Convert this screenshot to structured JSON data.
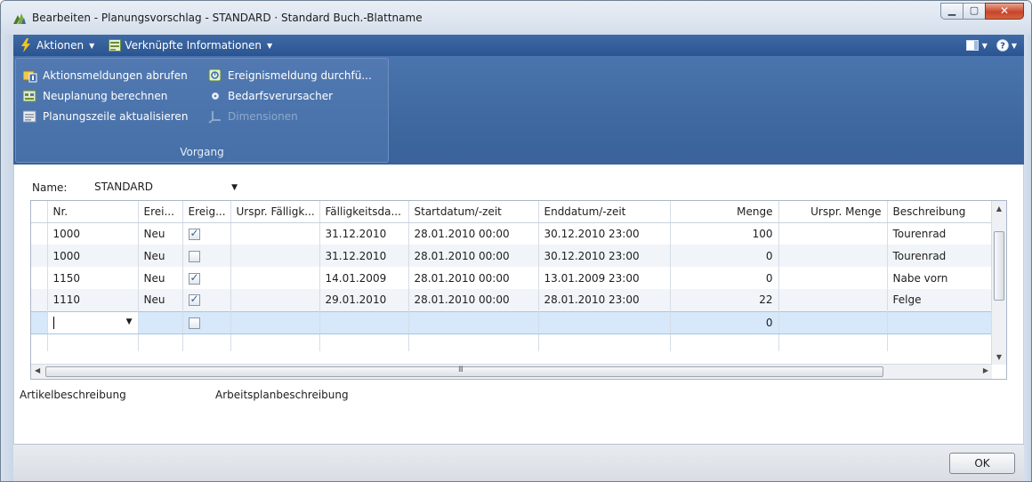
{
  "window": {
    "title": "Bearbeiten - Planungsvorschlag - STANDARD · Standard Buch.-Blattname"
  },
  "menubar": {
    "items": [
      {
        "label": "Aktionen",
        "icon": "lightning-icon"
      },
      {
        "label": "Verknüpfte Informationen",
        "icon": "linked-info-icon"
      }
    ]
  },
  "ribbon": {
    "group_label": "Vorgang",
    "actions": [
      {
        "label": "Aktionsmeldungen abrufen",
        "icon": "get-action-messages-icon",
        "enabled": true
      },
      {
        "label": "Neuplanung berechnen",
        "icon": "calculate-regenerative-plan-icon",
        "enabled": true
      },
      {
        "label": "Planungszeile aktualisieren",
        "icon": "refresh-planning-line-icon",
        "enabled": true
      },
      {
        "label": "Ereignismeldung durchfü...",
        "icon": "carry-out-action-message-icon",
        "enabled": true
      },
      {
        "label": "Bedarfsverursacher",
        "icon": "order-tracking-icon",
        "enabled": true
      },
      {
        "label": "Dimensionen",
        "icon": "dimensions-icon",
        "enabled": false
      }
    ]
  },
  "form": {
    "name_label": "Name:",
    "name_value": "STANDARD"
  },
  "grid": {
    "columns": [
      "Nr.",
      "Erei...",
      "Ereig...",
      "Urspr. Fälligk...",
      "Fälligkeitsda...",
      "Startdatum/-zeit",
      "Enddatum/-zeit",
      "Menge",
      "Urspr. Menge",
      "Beschreibung"
    ],
    "rows": [
      {
        "nr": "1000",
        "event": "Neu",
        "accept": true,
        "orig_due": "",
        "due": "31.12.2010",
        "start": "28.01.2010 00:00",
        "end": "30.12.2010 23:00",
        "qty": "100",
        "orig_qty": "",
        "desc": "Tourenrad"
      },
      {
        "nr": "1000",
        "event": "Neu",
        "accept": false,
        "orig_due": "",
        "due": "31.12.2010",
        "start": "28.01.2010 00:00",
        "end": "30.12.2010 23:00",
        "qty": "0",
        "orig_qty": "",
        "desc": "Tourenrad"
      },
      {
        "nr": "1150",
        "event": "Neu",
        "accept": true,
        "orig_due": "",
        "due": "14.01.2009",
        "start": "28.01.2010 00:00",
        "end": "13.01.2009 23:00",
        "qty": "0",
        "orig_qty": "",
        "desc": "Nabe vorn"
      },
      {
        "nr": "1110",
        "event": "Neu",
        "accept": true,
        "orig_due": "",
        "due": "29.01.2010",
        "start": "28.01.2010 00:00",
        "end": "28.01.2010 23:00",
        "qty": "22",
        "orig_qty": "",
        "desc": "Felge"
      }
    ],
    "new_row": {
      "qty": "0",
      "accept": false
    }
  },
  "factboxes": {
    "item_description": "Artikelbeschreibung",
    "routing_description": "Arbeitsplanbeschreibung"
  },
  "footer": {
    "ok_label": "OK"
  },
  "colors": {
    "ribbon_blue": "#3e689f",
    "selected_row": "#d6e8f9",
    "close_red": "#c7452a"
  }
}
